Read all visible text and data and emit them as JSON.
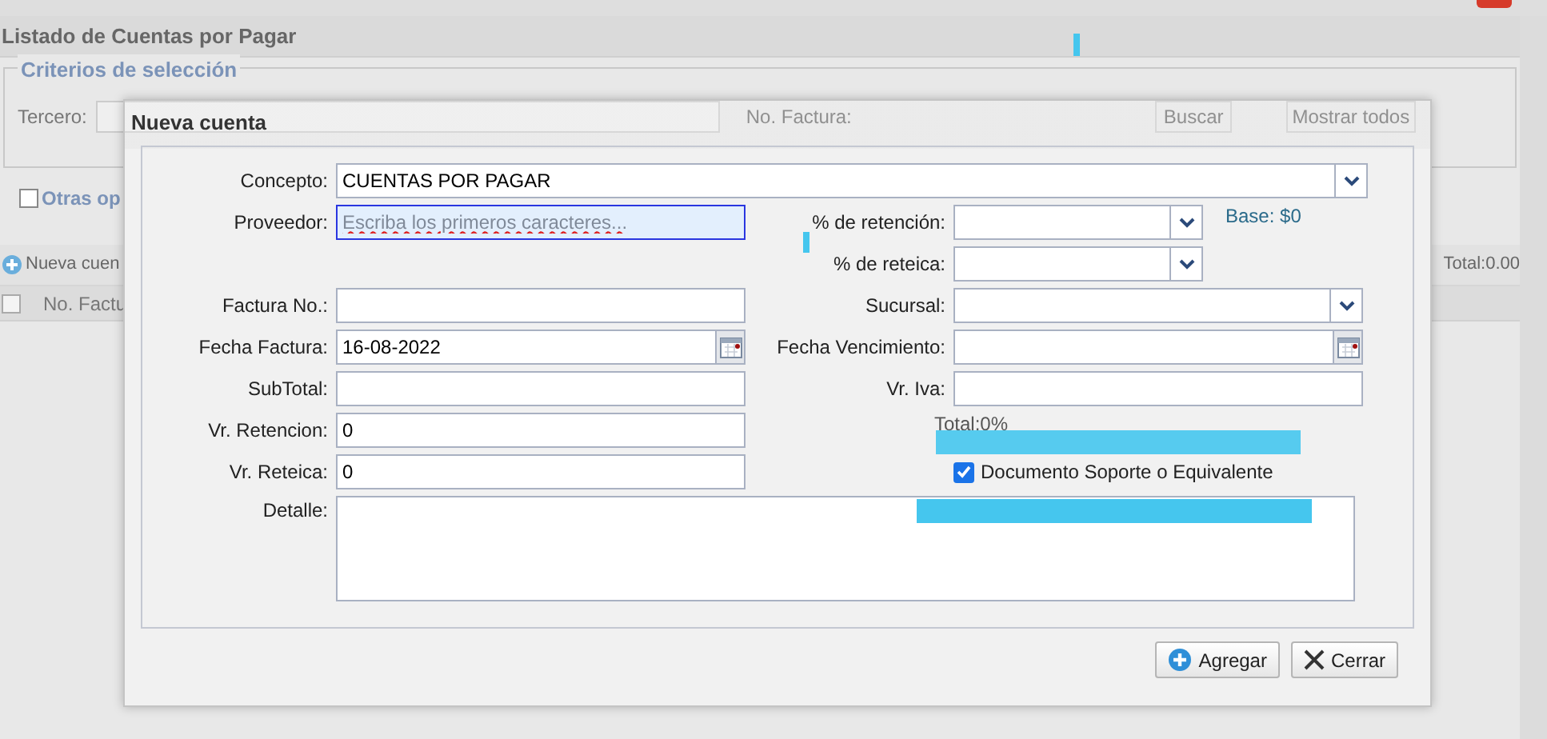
{
  "page": {
    "title": "Listado de Cuentas por Pagar",
    "criteria": {
      "legend": "Criterios de selección",
      "tercero_label": "Tercero:",
      "factura_label": "No. Factura:",
      "search_button": "Buscar",
      "show_all_button": "Mostrar todos"
    },
    "other_options": {
      "label": "Otras op",
      "checked": false
    },
    "toolbar": {
      "new_button": "Nueva cuen",
      "total": "Total:0.00"
    },
    "table": {
      "select_all_checked": false,
      "columns": [
        "No. Factu"
      ]
    }
  },
  "dialog": {
    "title": "Nueva cuenta",
    "concept": {
      "label": "Concepto:",
      "value": "CUENTAS POR PAGAR",
      "kind": "select"
    },
    "rows": [
      {
        "left": {
          "label": "Proveedor:",
          "kind": "text",
          "placeholder": "Escriba los primeros caracteres...",
          "focused": true
        },
        "right": {
          "label": "% de retención:",
          "kind": "short-select",
          "note": "Base: $0"
        }
      },
      {
        "right": {
          "label": "% de reteica:",
          "kind": "short-select"
        }
      },
      {
        "left": {
          "label": "Factura No.:",
          "kind": "text"
        },
        "right": {
          "label": "Sucursal:",
          "kind": "select"
        }
      },
      {
        "left": {
          "label": "Fecha Factura:",
          "kind": "date",
          "value": "16-08-2022"
        },
        "right": {
          "label": "Fecha Vencimiento:",
          "kind": "date"
        }
      },
      {
        "left": {
          "label": "SubTotal:",
          "kind": "text"
        },
        "right": {
          "label": "Vr. Iva:",
          "kind": "text"
        }
      },
      {
        "left": {
          "label": "Vr. Retencion:",
          "kind": "text",
          "value": "0"
        },
        "right": {
          "kind": "total",
          "text": "Total:0%"
        }
      },
      {
        "left": {
          "label": "Vr. Reteica:",
          "kind": "text",
          "value": "0"
        },
        "right": {
          "kind": "checkbox",
          "label": "Documento Soporte o Equivalente",
          "checked": true
        }
      }
    ],
    "detail": {
      "label": "Detalle:"
    },
    "buttons": [
      {
        "label": "Agregar",
        "kind": "add"
      },
      {
        "label": "Cerrar",
        "kind": "close"
      }
    ]
  }
}
